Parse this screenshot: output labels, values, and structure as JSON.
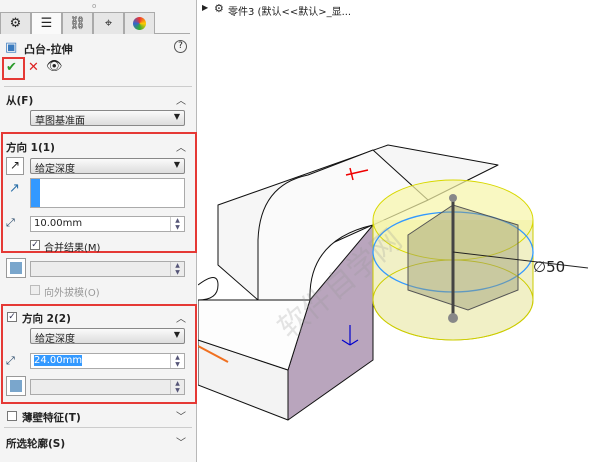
{
  "breadcrumb": {
    "text": "零件3 (默认<<默认>_显..."
  },
  "panel": {
    "tabs": [
      "feature-manager",
      "property-manager",
      "configuration-manager",
      "dimxpert",
      "display-manager"
    ],
    "title": "凸台-拉伸",
    "help": "?",
    "from": {
      "label": "从(F)",
      "value": "草图基准面"
    },
    "dir1": {
      "label": "方向 1(1)",
      "end_condition": "给定深度",
      "depth": "10.00mm",
      "merge_label": "合并结果(M)",
      "merge_checked": true,
      "draft_outward": "向外拔模(O)"
    },
    "dir2": {
      "label": "方向 2(2)",
      "checked": true,
      "end_condition": "给定深度",
      "depth": "24.00mm"
    },
    "thin": {
      "label": "薄壁特征(T)",
      "checked": false
    },
    "contours": {
      "label": "所选轮廓(S)"
    }
  },
  "viewport": {
    "dimension": "∅50",
    "watermark": "软件自学网 WWW.RJZXW.COM"
  },
  "colors": {
    "accent": "#e53935",
    "highlight": "#3399ff",
    "preview": "#f2f0a0"
  }
}
